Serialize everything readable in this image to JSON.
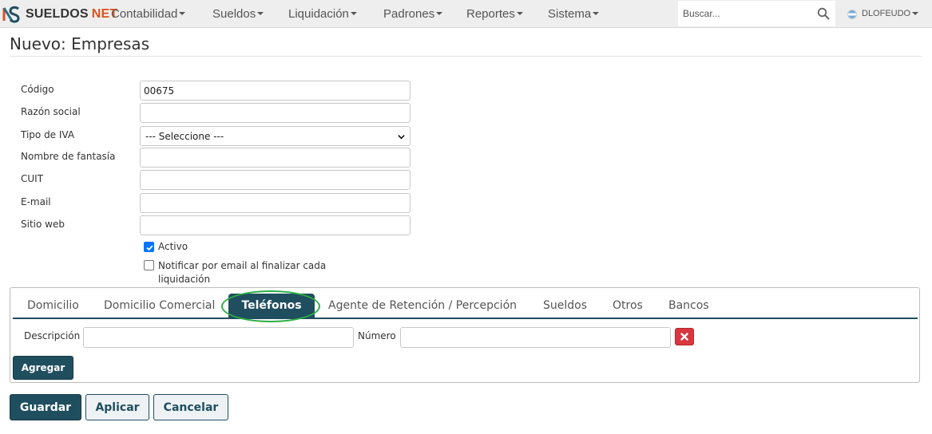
{
  "navbar": {
    "brand": {
      "name": "SUELDOS",
      "suffix": "NET",
      "logo_icon": "sueldos-net-logo-icon"
    },
    "menu": [
      {
        "label": "Contabilidad"
      },
      {
        "label": "Sueldos"
      },
      {
        "label": "Liquidación"
      },
      {
        "label": "Padrones"
      },
      {
        "label": "Reportes"
      },
      {
        "label": "Sistema"
      }
    ],
    "search": {
      "placeholder": "Buscar...",
      "icon": "search-icon"
    },
    "user": {
      "name": "DLOFEUDO",
      "flag_icon": "argentina-flag-icon"
    }
  },
  "page": {
    "title": "Nuevo: Empresas"
  },
  "form": {
    "codigo": {
      "label": "Código",
      "value": "00675"
    },
    "razon_social": {
      "label": "Razón social",
      "value": ""
    },
    "tipo_iva": {
      "label": "Tipo de IVA",
      "selected": "--- Seleccione ---"
    },
    "nombre_fantasia": {
      "label": "Nombre de fantasía",
      "value": ""
    },
    "cuit": {
      "label": "CUIT",
      "value": ""
    },
    "email": {
      "label": "E-mail",
      "value": ""
    },
    "sitio_web": {
      "label": "Sitio web",
      "value": ""
    },
    "activo": {
      "label": "Activo",
      "checked": true
    },
    "notificar": {
      "label_line1": "Notificar por email al finalizar cada",
      "label_line2": "liquidación",
      "checked": false
    }
  },
  "tabs": [
    {
      "label": "Domicilio"
    },
    {
      "label": "Domicilio Comercial"
    },
    {
      "label": "Teléfonos",
      "active": true
    },
    {
      "label": "Agente de Retención / Percepción"
    },
    {
      "label": "Sueldos"
    },
    {
      "label": "Otros"
    },
    {
      "label": "Bancos"
    }
  ],
  "telefonos": {
    "descripcion_label": "Descripción",
    "numero_label": "Número",
    "agregar_label": "Agregar",
    "delete_icon": "close-icon"
  },
  "actions": {
    "guardar": "Guardar",
    "aplicar": "Aplicar",
    "cancelar": "Cancelar"
  },
  "colors": {
    "primary": "#1f4e5f",
    "brand_accent": "#d9541e",
    "danger": "#d9363e",
    "highlight": "#2bae44"
  }
}
